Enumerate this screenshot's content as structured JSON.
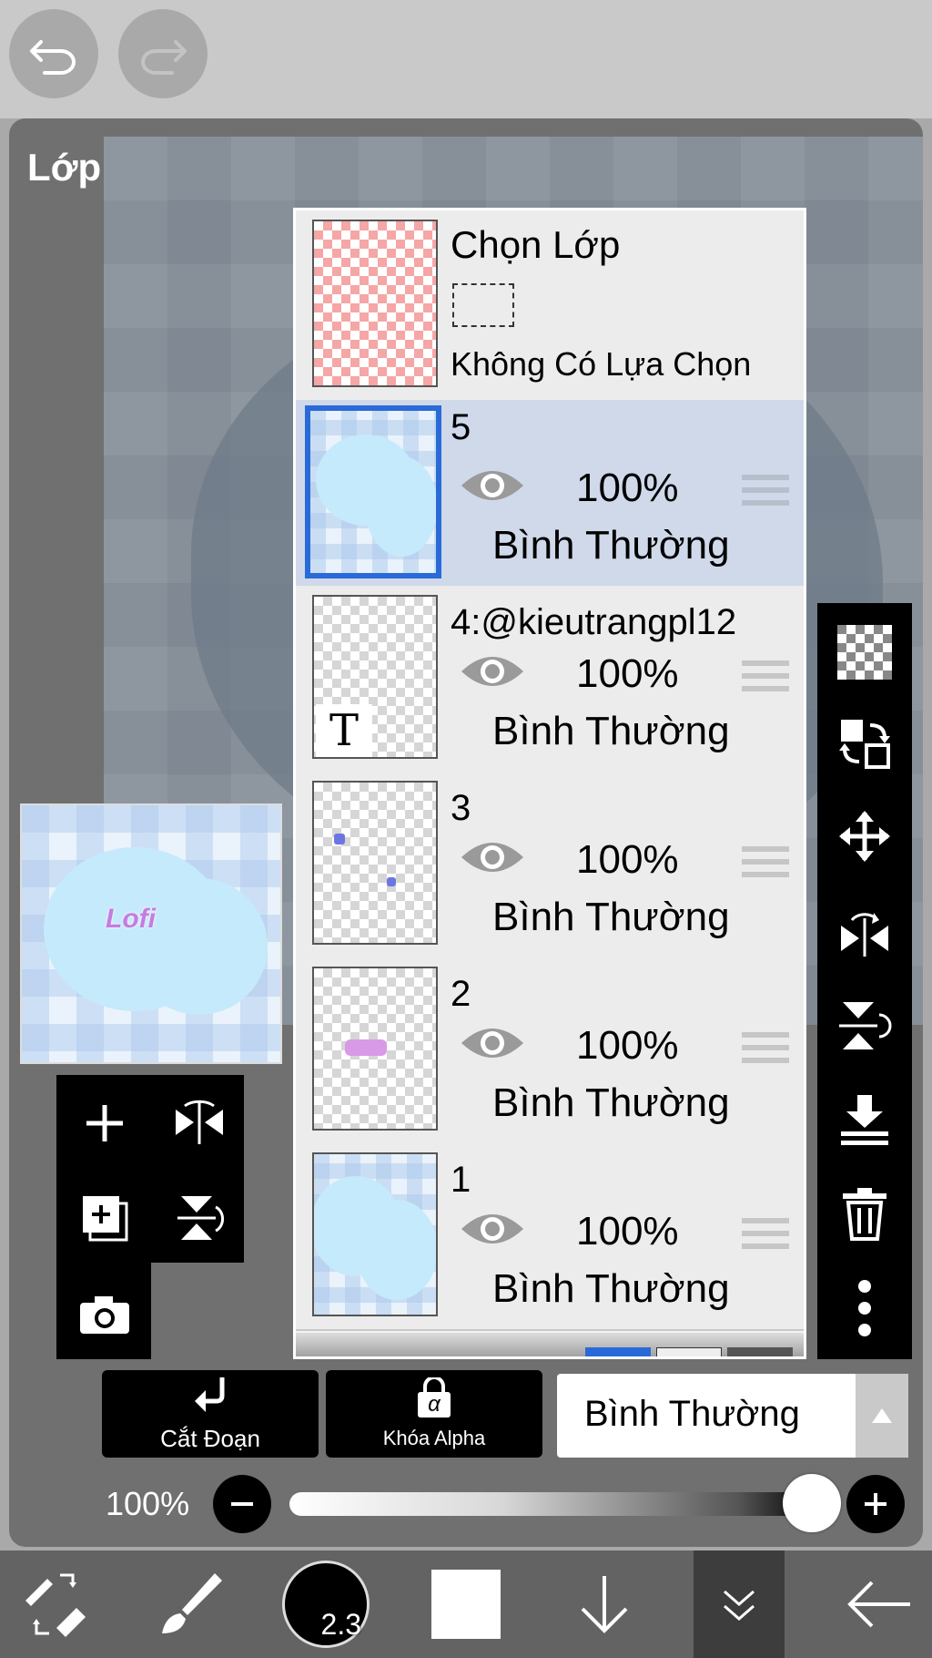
{
  "top_bar": {
    "undo_icon": "undo-icon",
    "redo_icon": "redo-icon"
  },
  "panel": {
    "title": "Lớp"
  },
  "selection_layer": {
    "title": "Chọn Lớp",
    "subtitle": "Không Có Lựa Chọn"
  },
  "layers": [
    {
      "name": "5",
      "opacity": "100%",
      "blend": "Bình Thường",
      "selected": true,
      "visible": true
    },
    {
      "name": "4:@kieutrangpl12",
      "opacity": "100%",
      "blend": "Bình Thường",
      "selected": false,
      "visible": true,
      "type": "text"
    },
    {
      "name": "3",
      "opacity": "100%",
      "blend": "Bình Thường",
      "selected": false,
      "visible": true
    },
    {
      "name": "2",
      "opacity": "100%",
      "blend": "Bình Thường",
      "selected": false,
      "visible": true
    },
    {
      "name": "1",
      "opacity": "100%",
      "blend": "Bình Thường",
      "selected": false,
      "visible": true
    }
  ],
  "text_layer_glyph": "T",
  "preview_text": "Lofi",
  "bottom_controls": {
    "clip_label": "Cắt Đoạn",
    "alpha_lock_label": "Khóa Alpha",
    "alpha_glyph": "α",
    "blend_mode": "Bình Thường",
    "opacity_label": "100%",
    "opacity_value": 1.0
  },
  "brush_size": "2.3",
  "colors": {
    "selection_blue": "#2a6ad8",
    "selected_row": "#cfd9ea",
    "panel_bg": "#707070"
  }
}
